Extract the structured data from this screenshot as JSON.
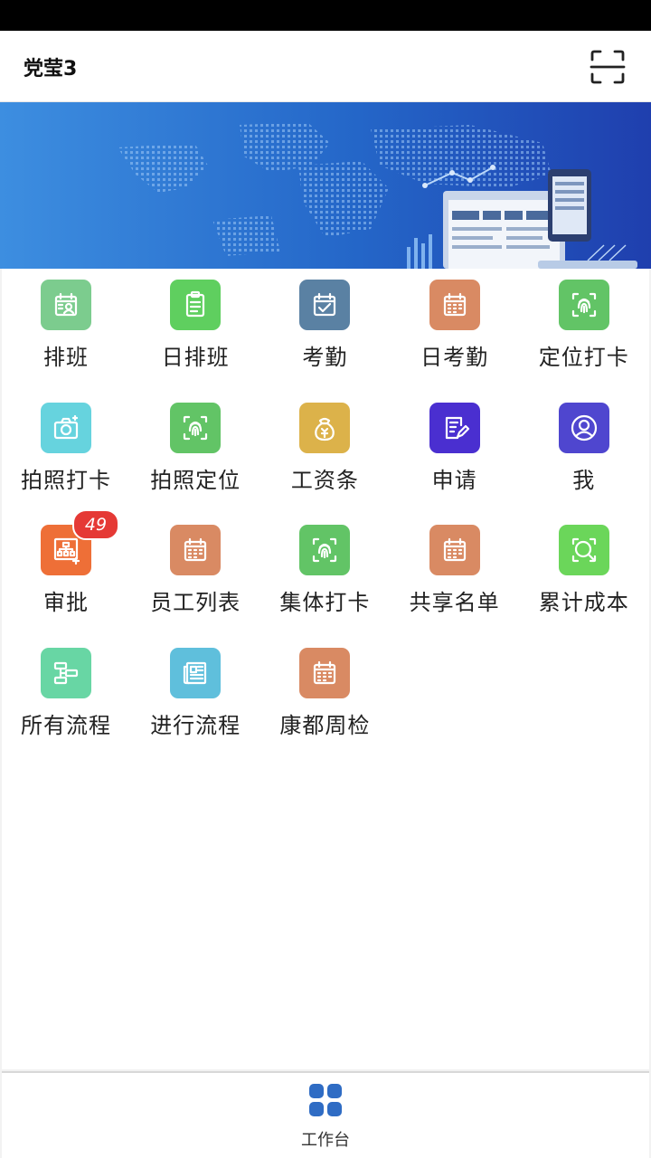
{
  "header": {
    "title": "党莹3"
  },
  "grid": {
    "tiles": [
      {
        "label": "排班",
        "icon": "schedule-person-icon",
        "color": "#7ccc8e"
      },
      {
        "label": "日排班",
        "icon": "clipboard-icon",
        "color": "#5fcf5f"
      },
      {
        "label": "考勤",
        "icon": "calendar-check-icon",
        "color": "#5a81a3"
      },
      {
        "label": "日考勤",
        "icon": "calendar-icon",
        "color": "#d98a63"
      },
      {
        "label": "定位打卡",
        "icon": "fingerprint-icon",
        "color": "#62c466"
      },
      {
        "label": "拍照打卡",
        "icon": "camera-icon",
        "color": "#66d3de"
      },
      {
        "label": "拍照定位",
        "icon": "fingerprint-icon",
        "color": "#62c466"
      },
      {
        "label": "工资条",
        "icon": "money-bag-icon",
        "color": "#dcb24a"
      },
      {
        "label": "申请",
        "icon": "edit-document-icon",
        "color": "#4a2fd0"
      },
      {
        "label": "我",
        "icon": "user-circle-icon",
        "color": "#4f46cf"
      },
      {
        "label": "审批",
        "icon": "org-chart-icon",
        "color": "#ee6f37",
        "badge": "49"
      },
      {
        "label": "员工列表",
        "icon": "calendar-icon",
        "color": "#d98a63"
      },
      {
        "label": "集体打卡",
        "icon": "fingerprint-icon",
        "color": "#62c466"
      },
      {
        "label": "共享名单",
        "icon": "calendar-icon",
        "color": "#d98a63"
      },
      {
        "label": "累计成本",
        "icon": "search-icon",
        "color": "#6bd65a"
      },
      {
        "label": "所有流程",
        "icon": "flow-icon",
        "color": "#68d6a4"
      },
      {
        "label": "进行流程",
        "icon": "newspaper-icon",
        "color": "#5fbfdc"
      },
      {
        "label": "康都周检",
        "icon": "calendar-icon",
        "color": "#d98a63"
      }
    ]
  },
  "tabbar": {
    "tabs": [
      {
        "label": "工作台",
        "icon": "grid-icon",
        "color": "#2f6cc4"
      }
    ]
  }
}
